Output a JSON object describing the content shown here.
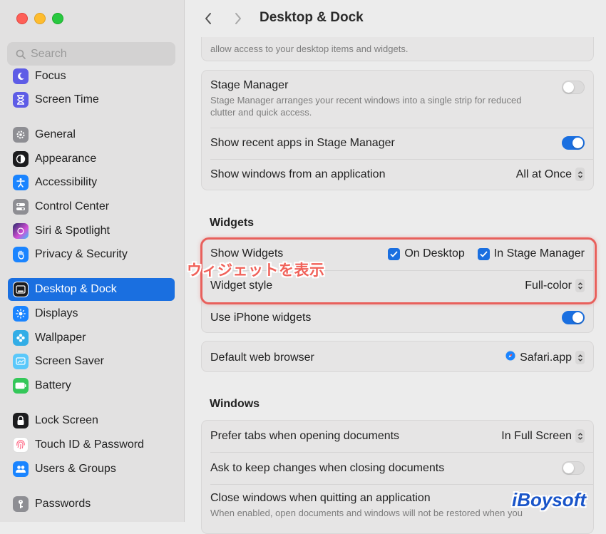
{
  "window": {
    "title": "Desktop & Dock"
  },
  "sidebar": {
    "search_placeholder": "Search",
    "items": [
      {
        "label": "Focus",
        "icon": "moon-icon",
        "color": "#5e5ce6"
      },
      {
        "label": "Screen Time",
        "icon": "hourglass-icon",
        "color": "#5e5ce6"
      },
      {
        "label": "General",
        "icon": "gear-icon",
        "color": "#8e8e93"
      },
      {
        "label": "Appearance",
        "icon": "appearance-icon",
        "color": "#1c1c1e"
      },
      {
        "label": "Accessibility",
        "icon": "accessibility-icon",
        "color": "#1a84ff"
      },
      {
        "label": "Control Center",
        "icon": "control-center-icon",
        "color": "#8e8e93"
      },
      {
        "label": "Siri & Spotlight",
        "icon": "siri-icon",
        "color": "#d34fd6"
      },
      {
        "label": "Privacy & Security",
        "icon": "hand-icon",
        "color": "#1a84ff"
      },
      {
        "label": "Desktop & Dock",
        "icon": "dock-icon",
        "color": "#1c1c1e"
      },
      {
        "label": "Displays",
        "icon": "sun-icon",
        "color": "#1a84ff"
      },
      {
        "label": "Wallpaper",
        "icon": "flower-icon",
        "color": "#32ade6"
      },
      {
        "label": "Screen Saver",
        "icon": "screensaver-icon",
        "color": "#5ac8fa"
      },
      {
        "label": "Battery",
        "icon": "battery-icon",
        "color": "#34c759"
      },
      {
        "label": "Lock Screen",
        "icon": "lock-icon",
        "color": "#1c1c1e"
      },
      {
        "label": "Touch ID & Password",
        "icon": "fingerprint-icon",
        "color": "#ff6482"
      },
      {
        "label": "Users & Groups",
        "icon": "users-icon",
        "color": "#1a84ff"
      },
      {
        "label": "Passwords",
        "icon": "key-icon",
        "color": "#8e8e93"
      }
    ]
  },
  "main": {
    "top_partial_text": "allow access to your desktop items and widgets.",
    "stage_manager": {
      "title": "Stage Manager",
      "description_line1": "Stage Manager arranges your recent windows into a single strip for reduced",
      "description_line2": "clutter and quick access.",
      "enabled": false,
      "recent_apps_label": "Show recent apps in Stage Manager",
      "recent_apps_on": true,
      "windows_from_app_label": "Show windows from an application",
      "windows_from_app_value": "All at Once"
    },
    "widgets": {
      "section_title": "Widgets",
      "show_widgets_label": "Show Widgets",
      "on_desktop_label": "On Desktop",
      "on_desktop_checked": true,
      "in_stage_manager_label": "In Stage Manager",
      "in_stage_manager_checked": true,
      "widget_style_label": "Widget style",
      "widget_style_value": "Full-color",
      "iphone_widgets_label": "Use iPhone widgets",
      "iphone_widgets_on": true
    },
    "browser": {
      "label": "Default web browser",
      "value": "Safari.app"
    },
    "windows": {
      "section_title": "Windows",
      "prefer_tabs_label": "Prefer tabs when opening documents",
      "prefer_tabs_value": "In Full Screen",
      "ask_keep_label": "Ask to keep changes when closing documents",
      "ask_keep_on": false,
      "close_windows_label": "Close windows when quitting an application",
      "close_windows_desc": "When enabled, open documents and windows will not be restored when you"
    }
  },
  "annotation": {
    "text": "ウィジェットを表示",
    "color": "#f0625a"
  },
  "watermark": {
    "text": "iBoysoft"
  },
  "colors": {
    "accent": "#1a6fe0",
    "highlight_border": "#e8605c"
  }
}
